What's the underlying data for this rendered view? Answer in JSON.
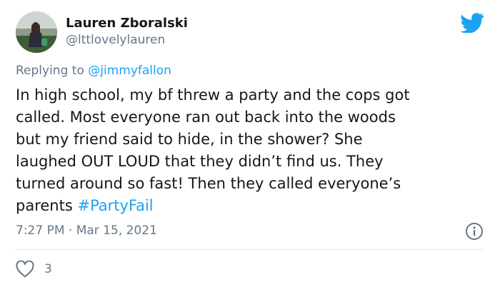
{
  "author": {
    "name": "Lauren Zboralski",
    "handle": "@lttlovelylauren",
    "avatar_icon": "avatar-photo"
  },
  "reply": {
    "prefix": "Replying to",
    "mention": "@jimmyfallon"
  },
  "tweet": {
    "text_lines": [
      "In high school, my bf threw a party and the cops got",
      "called. Most everyone ran out back into the woods",
      "but my friend said to hide, in the shower? She",
      "laughed OUT LOUD that they didn’t find us. They",
      "turned around so fast! Then they called everyone’s",
      "parents"
    ],
    "hashtag": "#PartyFail"
  },
  "meta": {
    "time": "7:27 PM",
    "separator": "·",
    "date": "Mar 15, 2021"
  },
  "actions": {
    "like_count": "3",
    "like_icon": "heart-icon",
    "info_icon": "info-icon"
  },
  "colors": {
    "brand": "#1da1f2",
    "muted": "#657786",
    "text": "#14171a",
    "divider": "#e1e8ed"
  }
}
